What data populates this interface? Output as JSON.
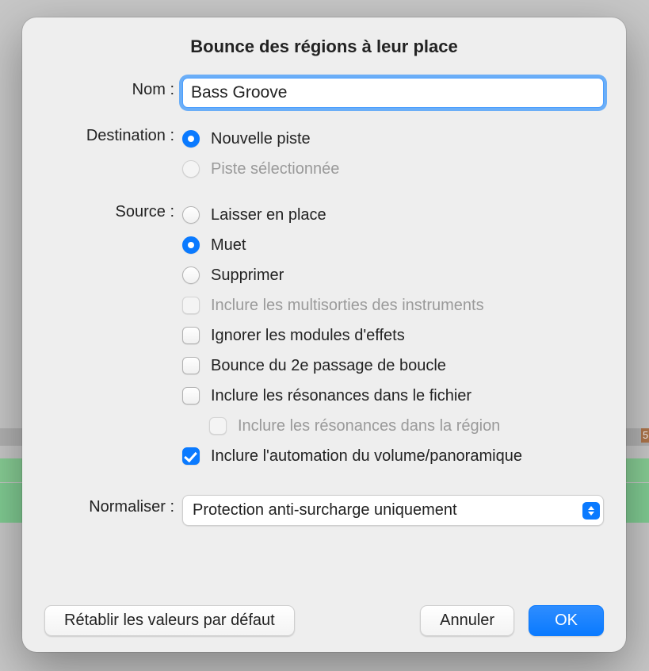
{
  "dialog": {
    "title": "Bounce des régions à leur place",
    "name": {
      "label": "Nom :",
      "value": "Bass Groove"
    },
    "destination": {
      "label": "Destination :",
      "options": {
        "new_track": "Nouvelle piste",
        "selected_track": "Piste sélectionnée"
      }
    },
    "source": {
      "label": "Source :",
      "options": {
        "leave": "Laisser en place",
        "mute": "Muet",
        "delete": "Supprimer"
      },
      "checks": {
        "include_multi": "Inclure les multisorties des instruments",
        "bypass_fx": "Ignorer les modules d'effets",
        "second_cycle": "Bounce du 2e passage de boucle",
        "tail_file": "Inclure les résonances dans le fichier",
        "tail_region": "Inclure les résonances dans la région",
        "include_automation": "Inclure l'automation du volume/panoramique"
      }
    },
    "normalize": {
      "label": "Normaliser :",
      "value": "Protection anti-surcharge uniquement"
    },
    "buttons": {
      "restore_defaults": "Rétablir les valeurs par défaut",
      "cancel": "Annuler",
      "ok": "OK"
    }
  }
}
